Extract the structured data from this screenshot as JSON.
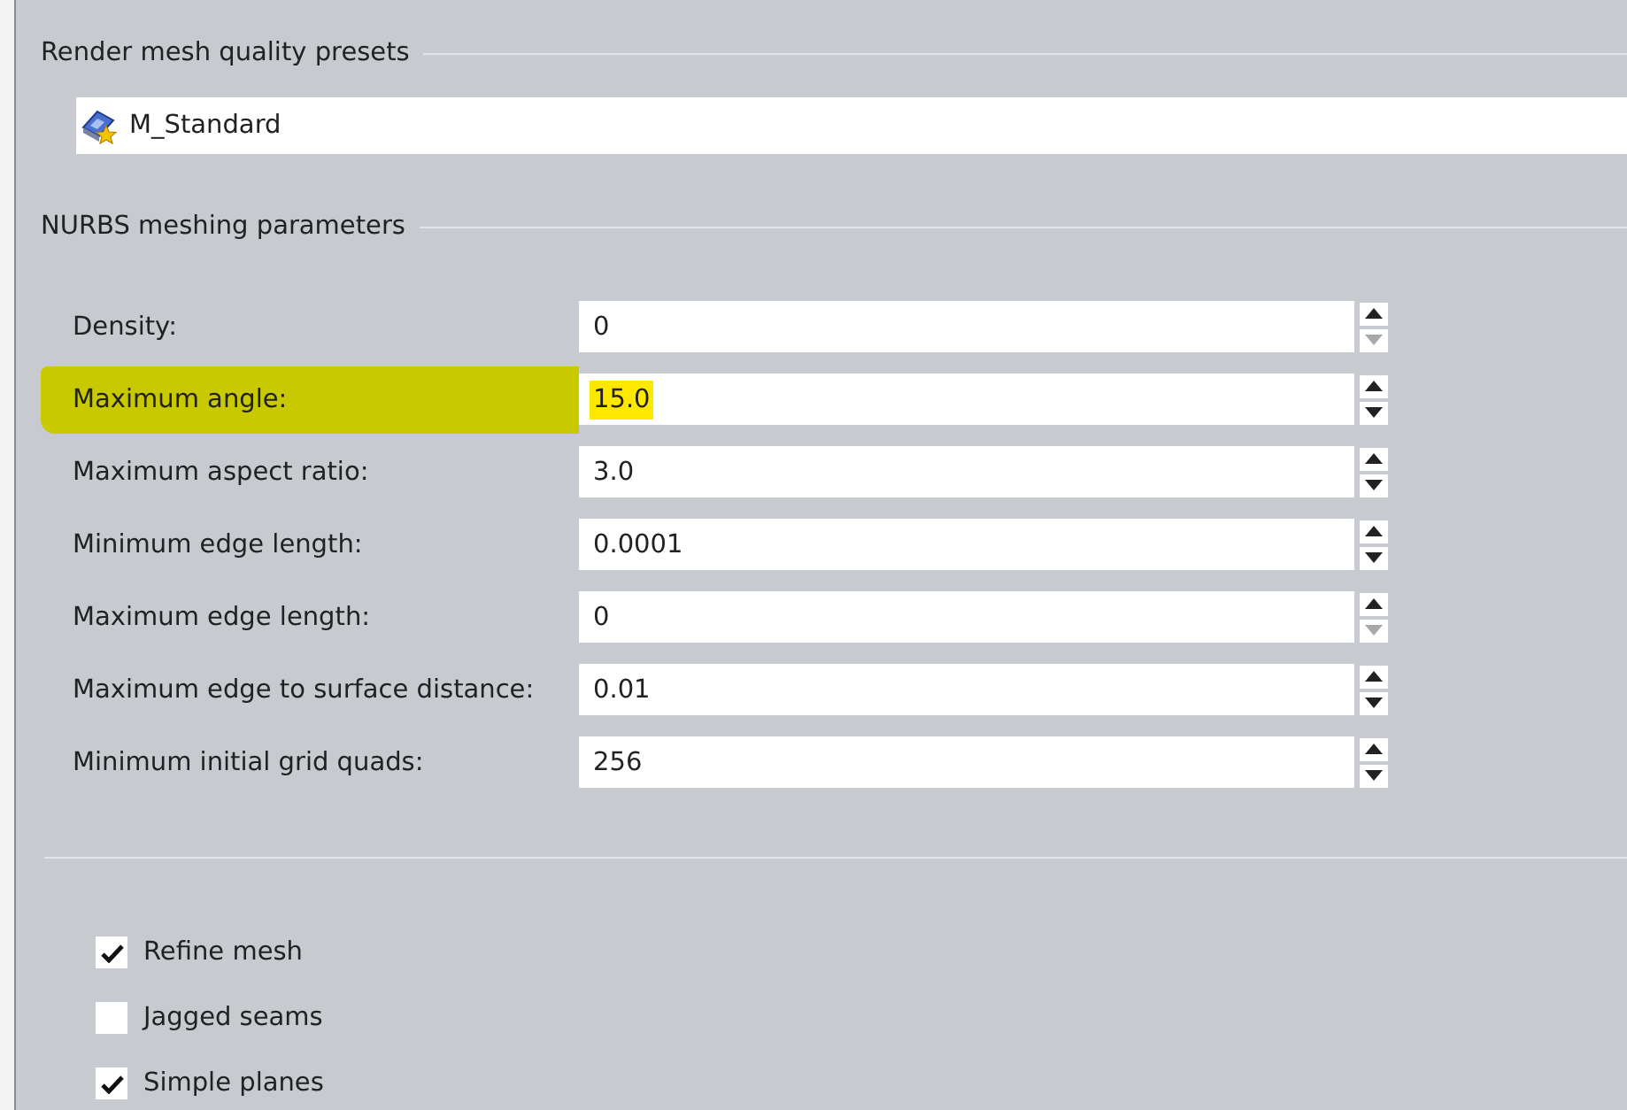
{
  "presets": {
    "title": "Render mesh quality presets",
    "value": "M_Standard"
  },
  "nurbs": {
    "title": "NURBS meshing parameters",
    "rows": [
      {
        "label": "Density:",
        "value": "0",
        "highlighted": false,
        "down_disabled": true
      },
      {
        "label": "Maximum angle:",
        "value": "15.0",
        "highlighted": true,
        "down_disabled": false
      },
      {
        "label": "Maximum aspect ratio:",
        "value": "3.0",
        "highlighted": false,
        "down_disabled": false
      },
      {
        "label": "Minimum edge length:",
        "value": "0.0001",
        "highlighted": false,
        "down_disabled": false
      },
      {
        "label": "Maximum edge length:",
        "value": "0",
        "highlighted": false,
        "down_disabled": true
      },
      {
        "label": "Maximum edge to surface distance:",
        "value": "0.01",
        "highlighted": false,
        "down_disabled": false
      },
      {
        "label": "Minimum initial grid quads:",
        "value": "256",
        "highlighted": false,
        "down_disabled": false
      }
    ]
  },
  "options": [
    {
      "label": "Refine mesh",
      "checked": true
    },
    {
      "label": "Jagged seams",
      "checked": false
    },
    {
      "label": "Simple planes",
      "checked": true
    }
  ]
}
